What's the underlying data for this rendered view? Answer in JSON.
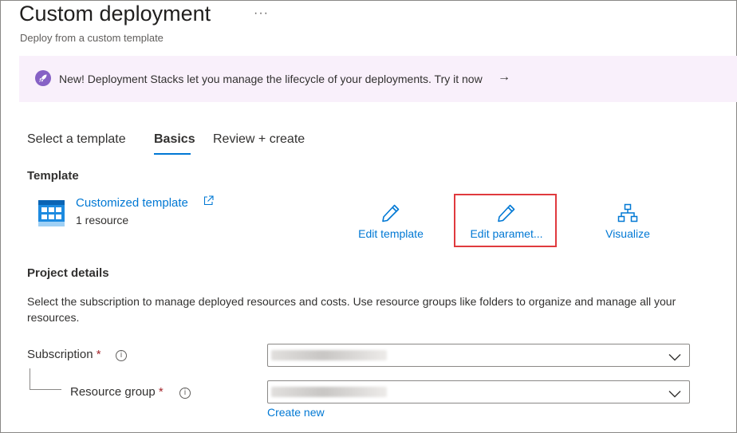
{
  "header": {
    "title": "Custom deployment",
    "more_label": "···",
    "subtitle": "Deploy from a custom template"
  },
  "banner": {
    "text": "New! Deployment Stacks let you manage the lifecycle of your deployments. Try it now",
    "arrow": "→",
    "icon": "rocket-icon",
    "background_color": "#f9f0fb",
    "icon_color": "#8661c5"
  },
  "tabs": [
    {
      "label": "Select a template",
      "selected": false
    },
    {
      "label": "Basics",
      "selected": true
    },
    {
      "label": "Review + create",
      "selected": false
    }
  ],
  "template": {
    "heading": "Template",
    "link_label": "Customized template",
    "resource_count": "1 resource",
    "actions": {
      "edit_template": "Edit template",
      "edit_parameters": "Edit paramet...",
      "visualize": "Visualize"
    }
  },
  "project": {
    "heading": "Project details",
    "description": "Select the subscription to manage deployed resources and costs. Use resource groups like folders to organize and manage all your resources.",
    "subscription_label": "Subscription",
    "resource_group_label": "Resource group",
    "required_marker": "*",
    "info_glyph": "i",
    "create_new": "Create new"
  },
  "colors": {
    "accent": "#0078d4",
    "highlight_box": "#e03a3e",
    "required": "#a4262c"
  }
}
